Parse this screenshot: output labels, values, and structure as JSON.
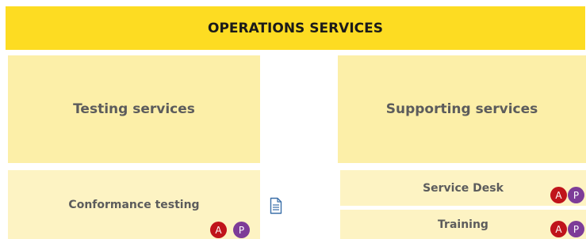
{
  "banner": {
    "title": "OPERATIONS SERVICES"
  },
  "columns": {
    "left": {
      "heading": "Testing services"
    },
    "right": {
      "heading": "Supporting services"
    }
  },
  "services": {
    "conformance_testing": {
      "label": "Conformance testing",
      "badges": [
        "A",
        "P"
      ]
    },
    "service_desk": {
      "label": "Service Desk",
      "badges": [
        "A",
        "P"
      ]
    },
    "training": {
      "label": "Training",
      "badges": [
        "A",
        "P"
      ]
    }
  },
  "icons": {
    "document": "document-icon"
  },
  "colors": {
    "banner": "#fddc22",
    "heading_box": "#fcefa8",
    "service_box": "#fdf3c3",
    "badge_a": "#c0141b",
    "badge_p": "#7d3c98"
  }
}
